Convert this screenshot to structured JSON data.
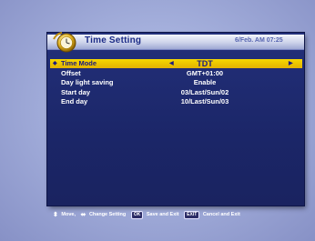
{
  "screen": {
    "title": "Time Setting",
    "datetime": "6/Feb. AM 07:25"
  },
  "menu": {
    "items": [
      {
        "label": "Time Mode",
        "value": "TDT",
        "selected": true
      },
      {
        "label": "Offset",
        "value": "GMT+01:00",
        "selected": false
      },
      {
        "label": "Day light saving",
        "value": "Enable",
        "selected": false
      },
      {
        "label": "Start day",
        "value": "03/Last/Sun/02",
        "selected": false
      },
      {
        "label": "End day",
        "value": "10/Last/Sun/03",
        "selected": false
      }
    ]
  },
  "footer": {
    "move_label": "Move,",
    "change_label": "Change Setting",
    "ok_key": "OK",
    "save_label": "Save and Exit",
    "exit_key": "EXIT",
    "cancel_label": "Cancel and Exit"
  },
  "colors": {
    "panel": "#1b2668",
    "highlight": "#f0c800",
    "background": "#a3aedb"
  }
}
